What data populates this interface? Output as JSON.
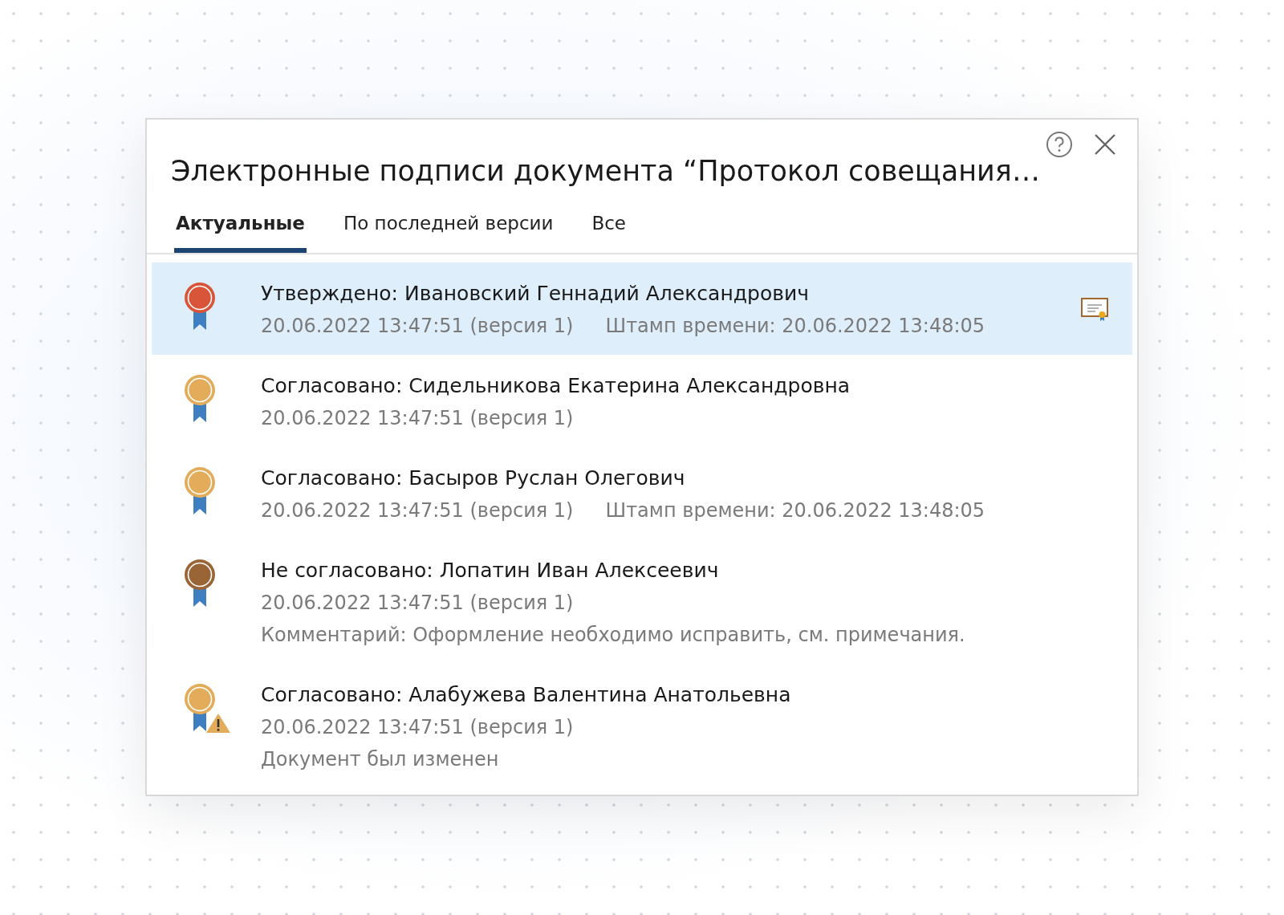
{
  "dialog": {
    "title": "Электронные подписи документа “Протокол совещания…",
    "tabs": [
      {
        "label": "Актуальные",
        "selected": true
      },
      {
        "label": "По последней версии",
        "selected": false
      },
      {
        "label": "Все",
        "selected": false
      }
    ],
    "signatures": [
      {
        "status": "Утверждено: Ивановский Геннадий Александрович",
        "date": "20.06.2022 13:47:51 (версия 1)",
        "timestamp": "Штамп времени: 20.06.2022  13:48:05",
        "color": "#d9553a",
        "warning": false,
        "certificate": true,
        "selected": true
      },
      {
        "status": "Согласовано: Сидельникова Екатерина Александровна",
        "date": "20.06.2022 13:47:51 (версия 1)",
        "color": "#e2ac5a",
        "warning": false,
        "certificate": false,
        "selected": false
      },
      {
        "status": "Согласовано: Басыров Руслан Олегович",
        "date": "20.06.2022 13:47:51 (версия 1)",
        "timestamp": "Штамп времени: 20.06.2022  13:48:05",
        "color": "#e2ac5a",
        "warning": false,
        "certificate": false,
        "selected": false
      },
      {
        "status": "Не согласовано: Лопатин Иван Алексеевич",
        "date": "20.06.2022 13:47:51 (версия 1)",
        "note": "Комментарий: Оформление необходимо исправить, см. примечания.",
        "color": "#9a6536",
        "warning": false,
        "certificate": false,
        "selected": false
      },
      {
        "status": "Согласовано: Алабужева Валентина Анатольевна",
        "date": "20.06.2022 13:47:51 (версия 1)",
        "note": "Документ был изменен",
        "color": "#e2ac5a",
        "warning": true,
        "certificate": false,
        "selected": false
      }
    ]
  }
}
